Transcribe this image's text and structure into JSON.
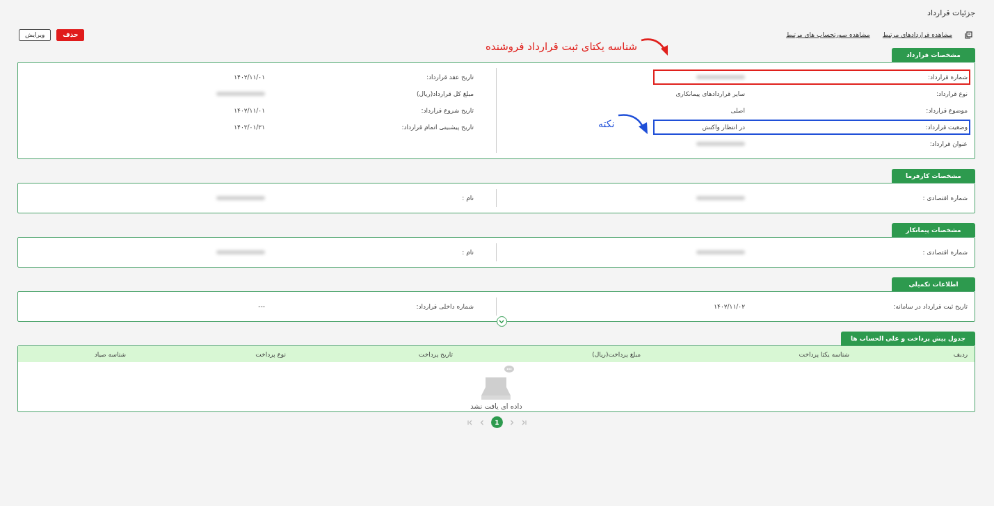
{
  "page": {
    "title": "جزئیات قرارداد"
  },
  "links": [
    {
      "label": "مشاهده قراردادهای مرتبط"
    },
    {
      "label": "مشاهده صورتحساب های مرتبط"
    }
  ],
  "buttons": [
    {
      "label": "حذف",
      "kind": "danger"
    },
    {
      "label": "ویرایش",
      "kind": "outline"
    }
  ],
  "annotations": [
    {
      "text": "شناسه یکتای ثبت قرارداد فروشنده",
      "color": "#e0201c"
    },
    {
      "text": "نکته",
      "color": "#1f4fd8"
    }
  ],
  "sections": [
    {
      "title": "مشخصات قرارداد",
      "columns": [
        [
          {
            "label": "شماره قرارداد:",
            "blurred": true,
            "color": "#e0201c"
          },
          {
            "label": "نوع قرارداد:",
            "value": "سایر قراردادهای پیمانکاری"
          },
          {
            "label": "موضوع قرارداد:",
            "value": "اصلی"
          },
          {
            "label": "وضعیت قرارداد:",
            "value": "در انتظار واکنش",
            "color": "#1f4fd8"
          },
          {
            "label": "عنوان قرارداد:",
            "blurred": true
          }
        ],
        [
          {
            "label": "تاریخ عقد قرارداد:",
            "value": "۱۴۰۲/۱۱/۰۱"
          },
          {
            "label": "مبلغ کل قرارداد(ریال)",
            "blurred": true
          },
          {
            "label": "تاریخ شروع قرارداد:",
            "value": "۱۴۰۲/۱۱/۰۱"
          },
          {
            "label": "تاریخ پیشبینی اتمام قرارداد:",
            "value": "۱۴۰۳/۰۱/۳۱"
          }
        ]
      ]
    },
    {
      "title": "مشخصات کارفرما",
      "columns": [
        [
          {
            "label": "شماره اقتصادی :",
            "blurred": true
          }
        ],
        [
          {
            "label": "نام :",
            "blurred": true
          }
        ]
      ]
    },
    {
      "title": "مشخصات پیمانکار",
      "columns": [
        [
          {
            "label": "شماره اقتصادی :",
            "blurred": true
          }
        ],
        [
          {
            "label": "نام :",
            "blurred": true
          }
        ]
      ]
    },
    {
      "title": "اطلاعات تکمیلی",
      "expandable": true,
      "columns": [
        [
          {
            "label": "تاریخ ثبت قرارداد در سامانه:",
            "value": "۱۴۰۲/۱۱/۰۲"
          }
        ],
        [
          {
            "label": "شماره داخلی قرارداد:",
            "value": "---"
          }
        ]
      ]
    }
  ],
  "table": {
    "title": "جدول پیش پرداخت و علی الحساب ها",
    "columns": [
      "ردیف",
      "شناسه یکتا پرداخت",
      "مبلغ پرداخت(ریال)",
      "تاریخ پرداخت",
      "نوع پرداخت",
      "شناسه صیاد"
    ],
    "empty_message": "داده ای یافت نشد"
  },
  "pagination": {
    "pages": [
      {
        "label": "1",
        "selected": true
      }
    ]
  }
}
